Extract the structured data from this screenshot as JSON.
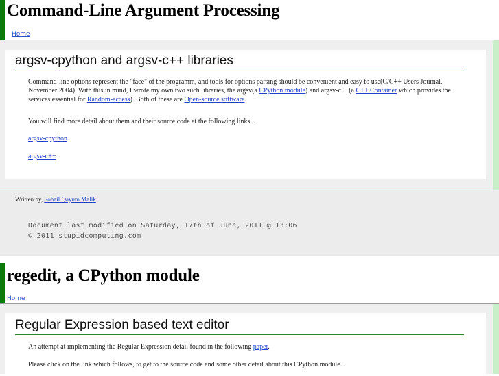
{
  "section1": {
    "title": "Command-Line Argument Processing",
    "home_link": "Home",
    "heading": "argsv-cpython and argsv-c++ libraries",
    "para1_a": "Command-line options represent the \"face\" of the programm, and tools for options parsing should be convenient and easy to use(C/C++ Users Journal, November 2004). With this in mind, I wrote my own two such libraries, the argsv(a ",
    "link_cpython_module": "CPython module",
    "para1_b": ") and argsv-c++(a ",
    "link_cpp_container": "C++ Container",
    "para1_c": " which provides the services essential for ",
    "link_random_access": "Random-access",
    "para1_d": "). Both of these are ",
    "link_open_source": "Open-source software",
    "para1_e": ".",
    "para2": "You will find more detail about them and their source code at the following links...",
    "link_argsv_cpython": "argsv-cpython",
    "link_argsv_cpp": "argsv-c++",
    "written_by": "Written by, ",
    "author": "Sohail Qayum Malik ",
    "modified": "Document last modified on Saturday, 17th of June, 2011 @ 13:06",
    "copyright": "© 2011 stupidcomputing.com"
  },
  "section2": {
    "title": "regedit, a CPython module",
    "home_link": "Home",
    "heading": "Regular Expression based text editor",
    "para1_a": "An attempt at implementing the Regular Expression detail found in the following ",
    "link_paper": "paper",
    "para1_b": ".",
    "para2": "Please click on the link which follows, to get to the source code and some other detail about this CPython module..."
  },
  "colors": {
    "accent_green": "#0a7a0a",
    "rule_green": "#2a8a2a",
    "link_blue": "#2340c8",
    "panel_grey": "#efefef",
    "stripe_green": "#c8efc8"
  }
}
